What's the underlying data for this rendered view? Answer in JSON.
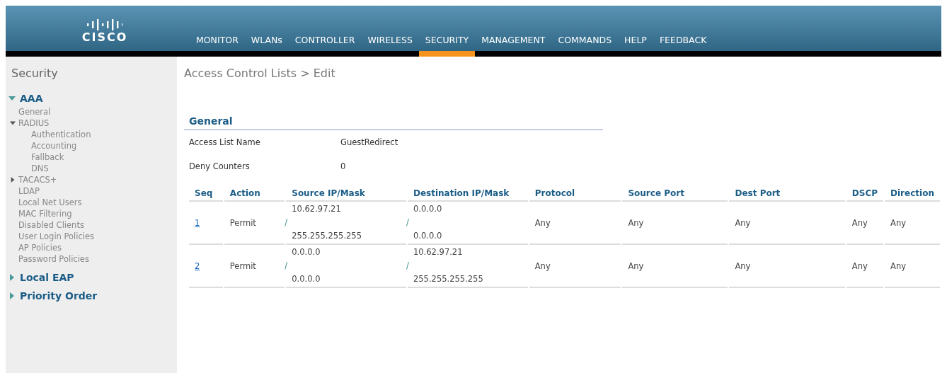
{
  "header": {
    "logo_text": "CISCO",
    "menu": [
      {
        "label": "MONITOR",
        "selected": false
      },
      {
        "label": "WLANs",
        "selected": false
      },
      {
        "label": "CONTROLLER",
        "selected": false
      },
      {
        "label": "WIRELESS",
        "selected": false
      },
      {
        "label": "SECURITY",
        "selected": true
      },
      {
        "label": "MANAGEMENT",
        "selected": false
      },
      {
        "label": "COMMANDS",
        "selected": false
      },
      {
        "label": "HELP",
        "selected": false
      },
      {
        "label": "FEEDBACK",
        "selected": false
      }
    ]
  },
  "sidebar": {
    "title": "Security",
    "items": [
      {
        "label": "AAA",
        "expanded": true,
        "children": [
          {
            "label": "General"
          },
          {
            "label": "RADIUS",
            "expanded": true,
            "children": [
              {
                "label": "Authentication"
              },
              {
                "label": "Accounting"
              },
              {
                "label": "Fallback"
              },
              {
                "label": "DNS"
              }
            ]
          },
          {
            "label": "TACACS+",
            "expanded": false
          },
          {
            "label": "LDAP"
          },
          {
            "label": "Local Net Users"
          },
          {
            "label": "MAC Filtering"
          },
          {
            "label": "Disabled Clients"
          },
          {
            "label": "User Login Policies"
          },
          {
            "label": "AP Policies"
          },
          {
            "label": "Password Policies"
          }
        ]
      },
      {
        "label": "Local EAP",
        "expanded": false
      },
      {
        "label": "Priority Order",
        "expanded": false
      }
    ]
  },
  "page_title": "Access Control Lists > Edit",
  "general": {
    "heading": "General",
    "fields": [
      {
        "label": "Access List Name",
        "value": "GuestRedirect"
      },
      {
        "label": "Deny Counters",
        "value": "0"
      }
    ]
  },
  "table": {
    "columns": [
      "Seq",
      "Action",
      "Source IP/Mask",
      "Destination IP/Mask",
      "Protocol",
      "Source Port",
      "Dest Port",
      "DSCP",
      "Direction"
    ],
    "rows": [
      {
        "seq": "1",
        "action": "Permit",
        "source": [
          "10.62.97.21",
          "/",
          "255.255.255.255"
        ],
        "destination": [
          "0.0.0.0",
          "/",
          "0.0.0.0"
        ],
        "protocol": "Any",
        "source_port": "Any",
        "dest_port": "Any",
        "dscp": "Any",
        "direction": "Any"
      },
      {
        "seq": "2",
        "action": "Permit",
        "source": [
          "0.0.0.0",
          "/",
          "0.0.0.0"
        ],
        "destination": [
          "10.62.97.21",
          "/",
          "255.255.255.255"
        ],
        "protocol": "Any",
        "source_port": "Any",
        "dest_port": "Any",
        "dscp": "Any",
        "direction": "Any"
      }
    ]
  }
}
